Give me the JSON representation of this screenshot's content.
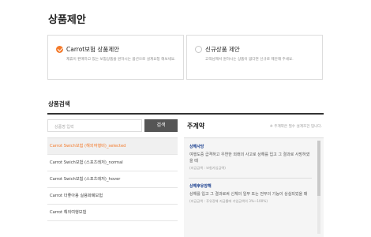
{
  "page": {
    "title": "상품제안"
  },
  "options": [
    {
      "title": "Carrot보험 상품제안",
      "desc": "제휴이 판매하고 있는 보험상품을 원하시는 옵션으로 설계요청 해보세요.",
      "selected": true
    },
    {
      "title": "신규상품 제안",
      "desc": "고객님께서 원하시는 상품이 없다면 신규로 제안해 주세요.",
      "selected": false
    }
  ],
  "search": {
    "section_title": "상품검색",
    "placeholder": "상품명 입력",
    "button_label": "검색"
  },
  "products": [
    {
      "label": "Carrot Swich보험 (해외여행비)_selected",
      "selected": true
    },
    {
      "label": "Carrot Swich보험 (스포츠레저)_normal",
      "selected": false
    },
    {
      "label": "Carrot Swich보험 (스포츠레저)_hover",
      "selected": false
    },
    {
      "label": "Carrot 더좋아용 실용화폐보험",
      "selected": false
    },
    {
      "label": "Carrot 해외여행보험",
      "selected": false
    }
  ],
  "detail": {
    "title": "주계약",
    "note": "※ 주계약은 필수 설계조건 입니다.",
    "coverages": [
      {
        "name": "상해사망",
        "desc": "여행도중 급격하고 우연한 외래의 사고로 상해를 입고 그 결과로 사망하였을 때",
        "sub": "(지급금액 : 보험가입금액)"
      },
      {
        "name": "상해후유장해",
        "desc": "상해를 입고 그 결과로써 신체의 일부 또는 전부의 기능이 상실되었을 때",
        "sub": "(지급금액 : 후유장해 지급률에 가입금액의 3%~100%)"
      }
    ]
  },
  "colors": {
    "accent": "#f47a2a",
    "button": "#555555",
    "coverage_title": "#1a3f8f"
  },
  "icons": {
    "selected_option": "check-circle-icon",
    "unselected_option": "radio-empty-icon"
  }
}
